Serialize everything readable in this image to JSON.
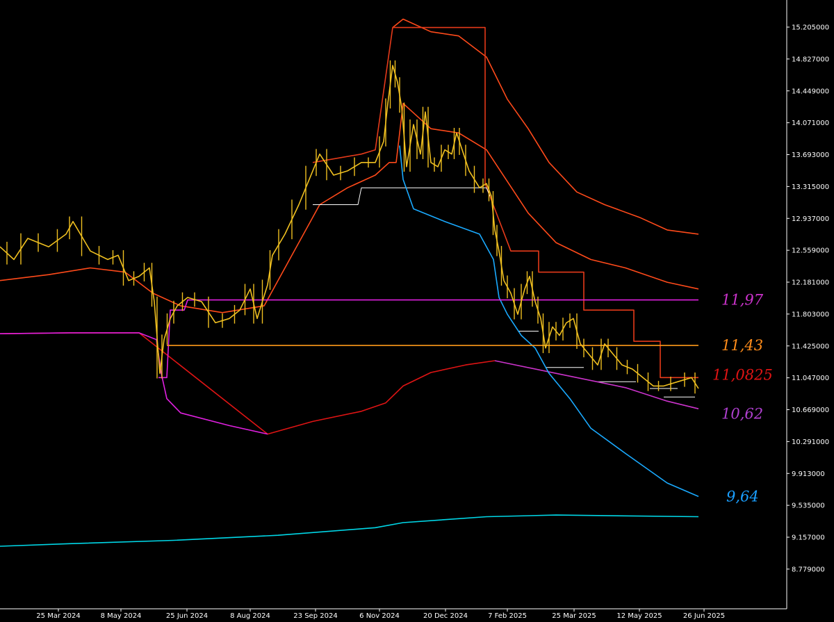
{
  "chart_data": {
    "type": "line",
    "title": "",
    "xlabel": "",
    "ylabel": "",
    "ylim": [
      8.5,
      15.4
    ],
    "grid": false,
    "legend": "none",
    "x_ticks": [
      "25 Mar 2024",
      "8 May 2024",
      "25 Jun 2024",
      "8 Aug 2024",
      "23 Sep 2024",
      "6 Nov 2024",
      "20 Dec 2024",
      "7 Feb 2025",
      "25 Mar 2025",
      "12 May 2025",
      "26 Jun 2025"
    ],
    "y_ticks": [
      "15.205000",
      "14.827000",
      "14.449000",
      "14.071000",
      "13.693000",
      "13.315000",
      "12.937000",
      "12.559000",
      "12.181000",
      "11.803000",
      "11.425000",
      "11.047000",
      "10.669000",
      "10.291000",
      "9.913000",
      "9.535000",
      "9.157000",
      "8.779000"
    ],
    "levels": [
      {
        "label": "11,97",
        "value": 11.97,
        "color": "#cc33cc",
        "style": "horizontal"
      },
      {
        "label": "11,43",
        "value": 11.43,
        "color": "#ff8c1a",
        "style": "horizontal"
      },
      {
        "label": "11,0825",
        "value": 11.0825,
        "color": "#e01414",
        "style": "marker"
      },
      {
        "label": "10,62",
        "value": 10.62,
        "color": "#b040d0",
        "style": "marker"
      },
      {
        "label": "9,64",
        "value": 9.64,
        "color": "#1a9fff",
        "style": "marker"
      }
    ],
    "series": [
      {
        "color": "#ff4a1a",
        "values": [
          [
            0,
            12.2
          ],
          [
            70,
            12.27
          ],
          [
            130,
            12.35
          ],
          [
            180,
            12.3
          ],
          [
            220,
            12.05
          ],
          [
            260,
            11.9
          ],
          [
            320,
            11.82
          ],
          [
            380,
            11.9
          ],
          [
            420,
            12.5
          ],
          [
            460,
            13.1
          ],
          [
            500,
            13.3
          ],
          [
            540,
            13.45
          ],
          [
            560,
            13.6
          ],
          [
            570,
            13.6
          ],
          [
            580,
            14.3
          ],
          [
            620,
            14.0
          ],
          [
            660,
            13.95
          ],
          [
            700,
            13.75
          ],
          [
            720,
            13.5
          ],
          [
            760,
            13.0
          ],
          [
            800,
            12.65
          ],
          [
            850,
            12.45
          ],
          [
            900,
            12.35
          ],
          [
            960,
            12.18
          ],
          [
            1005,
            12.1
          ]
        ]
      },
      {
        "color": "#ff4a1a",
        "values": [
          [
            565,
            15.2
          ],
          [
            580,
            15.3
          ],
          [
            620,
            15.15
          ],
          [
            660,
            15.1
          ],
          [
            700,
            14.85
          ],
          [
            730,
            14.35
          ],
          [
            760,
            14.0
          ],
          [
            790,
            13.6
          ],
          [
            830,
            13.25
          ],
          [
            870,
            13.1
          ],
          [
            920,
            12.95
          ],
          [
            960,
            12.8
          ],
          [
            1005,
            12.75
          ]
        ]
      },
      {
        "color": "#e63a1a",
        "values": [
          [
            450,
            13.6
          ],
          [
            520,
            13.7
          ],
          [
            540,
            13.75
          ],
          [
            565,
            15.2
          ],
          [
            698,
            15.2
          ],
          [
            698,
            13.35
          ],
          [
            735,
            12.55
          ],
          [
            775,
            12.55
          ],
          [
            775,
            12.3
          ],
          [
            840,
            12.3
          ],
          [
            840,
            11.85
          ],
          [
            912,
            11.85
          ],
          [
            912,
            11.48
          ],
          [
            950,
            11.48
          ],
          [
            950,
            11.05
          ],
          [
            1005,
            11.05
          ]
        ]
      },
      {
        "color": "#ffffff",
        "values": [
          [
            450,
            13.1
          ],
          [
            515,
            13.1
          ],
          [
            520,
            13.3
          ],
          [
            700,
            13.3
          ],
          [
            705,
            13.2
          ]
        ]
      },
      {
        "color": "#ffffff",
        "values": [
          [
            745,
            11.6
          ],
          [
            775,
            11.6
          ]
        ]
      },
      {
        "color": "#ffffff",
        "values": [
          [
            785,
            11.17
          ],
          [
            840,
            11.17
          ]
        ]
      },
      {
        "color": "#ffffff",
        "values": [
          [
            860,
            11.0
          ],
          [
            915,
            11.0
          ]
        ]
      },
      {
        "color": "#ffffff",
        "values": [
          [
            935,
            10.92
          ],
          [
            975,
            10.92
          ]
        ]
      },
      {
        "color": "#ffffff",
        "values": [
          [
            955,
            10.82
          ],
          [
            1000,
            10.82
          ]
        ]
      },
      {
        "color": "#e01414",
        "values": [
          [
            0,
            11.57
          ],
          [
            100,
            11.58
          ],
          [
            200,
            11.58
          ],
          [
            385,
            10.38
          ],
          [
            450,
            10.53
          ],
          [
            520,
            10.65
          ],
          [
            555,
            10.75
          ],
          [
            580,
            10.95
          ],
          [
            620,
            11.11
          ],
          [
            670,
            11.2
          ],
          [
            712,
            11.25
          ]
        ]
      },
      {
        "color": "#e020e0",
        "values": [
          [
            0,
            11.57
          ],
          [
            100,
            11.58
          ],
          [
            200,
            11.58
          ],
          [
            225,
            11.5
          ],
          [
            232,
            11.1
          ],
          [
            240,
            10.8
          ],
          [
            260,
            10.63
          ],
          [
            330,
            10.48
          ],
          [
            385,
            10.38
          ]
        ]
      },
      {
        "color": "#cc33cc",
        "values": [
          [
            712,
            11.25
          ],
          [
            800,
            11.1
          ],
          [
            900,
            10.93
          ],
          [
            960,
            10.77
          ],
          [
            1005,
            10.68
          ]
        ]
      },
      {
        "color": "#1aaaff",
        "values": [
          [
            575,
            13.8
          ],
          [
            580,
            13.4
          ],
          [
            595,
            13.05
          ],
          [
            640,
            12.9
          ],
          [
            690,
            12.75
          ],
          [
            710,
            12.45
          ],
          [
            718,
            12.0
          ],
          [
            730,
            11.8
          ],
          [
            750,
            11.55
          ],
          [
            770,
            11.4
          ],
          [
            790,
            11.1
          ],
          [
            820,
            10.8
          ],
          [
            850,
            10.45
          ],
          [
            900,
            10.15
          ],
          [
            960,
            9.8
          ],
          [
            1005,
            9.64
          ]
        ]
      },
      {
        "color": "#00d8e8",
        "values": [
          [
            0,
            9.05
          ],
          [
            100,
            9.08
          ],
          [
            250,
            9.12
          ],
          [
            400,
            9.18
          ],
          [
            540,
            9.27
          ],
          [
            580,
            9.33
          ],
          [
            700,
            9.4
          ],
          [
            800,
            9.42
          ],
          [
            1005,
            9.4
          ]
        ]
      },
      {
        "color": "#e020e0",
        "values": [
          [
            228,
            11.05
          ],
          [
            240,
            11.05
          ],
          [
            245,
            11.85
          ],
          [
            265,
            11.85
          ],
          [
            270,
            11.97
          ],
          [
            1005,
            11.97
          ]
        ]
      },
      {
        "color": "#ff9a1a",
        "values": [
          [
            240,
            11.43
          ],
          [
            1005,
            11.43
          ]
        ]
      },
      {
        "color": "#f0c020",
        "kind": "price",
        "values": [
          [
            0,
            12.6
          ],
          [
            20,
            12.45
          ],
          [
            40,
            12.7
          ],
          [
            70,
            12.6
          ],
          [
            95,
            12.75
          ],
          [
            105,
            12.9
          ],
          [
            130,
            12.55
          ],
          [
            155,
            12.45
          ],
          [
            170,
            12.5
          ],
          [
            185,
            12.2
          ],
          [
            200,
            12.25
          ],
          [
            215,
            12.35
          ],
          [
            222,
            11.95
          ],
          [
            230,
            11.1
          ],
          [
            236,
            11.5
          ],
          [
            245,
            11.75
          ],
          [
            255,
            11.9
          ],
          [
            270,
            12.0
          ],
          [
            290,
            11.95
          ],
          [
            310,
            11.7
          ],
          [
            330,
            11.75
          ],
          [
            345,
            11.85
          ],
          [
            360,
            12.1
          ],
          [
            370,
            11.75
          ],
          [
            385,
            12.15
          ],
          [
            392,
            12.5
          ],
          [
            410,
            12.75
          ],
          [
            430,
            13.1
          ],
          [
            450,
            13.5
          ],
          [
            460,
            13.7
          ],
          [
            480,
            13.45
          ],
          [
            500,
            13.5
          ],
          [
            520,
            13.6
          ],
          [
            540,
            13.6
          ],
          [
            552,
            13.85
          ],
          [
            558,
            14.3
          ],
          [
            565,
            14.75
          ],
          [
            572,
            14.55
          ],
          [
            578,
            14.25
          ],
          [
            585,
            13.55
          ],
          [
            595,
            14.05
          ],
          [
            605,
            13.7
          ],
          [
            612,
            14.2
          ],
          [
            620,
            13.6
          ],
          [
            630,
            13.55
          ],
          [
            640,
            13.75
          ],
          [
            650,
            13.7
          ],
          [
            657,
            13.95
          ],
          [
            665,
            13.75
          ],
          [
            675,
            13.5
          ],
          [
            690,
            13.3
          ],
          [
            700,
            13.35
          ],
          [
            707,
            13.2
          ],
          [
            712,
            12.8
          ],
          [
            718,
            12.55
          ],
          [
            725,
            12.2
          ],
          [
            735,
            12.05
          ],
          [
            745,
            11.8
          ],
          [
            755,
            12.1
          ],
          [
            762,
            12.25
          ],
          [
            770,
            11.95
          ],
          [
            778,
            11.75
          ],
          [
            785,
            11.4
          ],
          [
            795,
            11.65
          ],
          [
            805,
            11.55
          ],
          [
            815,
            11.7
          ],
          [
            825,
            11.75
          ],
          [
            835,
            11.45
          ],
          [
            845,
            11.35
          ],
          [
            860,
            11.2
          ],
          [
            870,
            11.45
          ],
          [
            880,
            11.35
          ],
          [
            895,
            11.2
          ],
          [
            910,
            11.15
          ],
          [
            925,
            11.05
          ],
          [
            940,
            10.95
          ],
          [
            955,
            10.95
          ],
          [
            975,
            11.0
          ],
          [
            995,
            11.05
          ],
          [
            1005,
            10.92
          ]
        ]
      }
    ]
  }
}
